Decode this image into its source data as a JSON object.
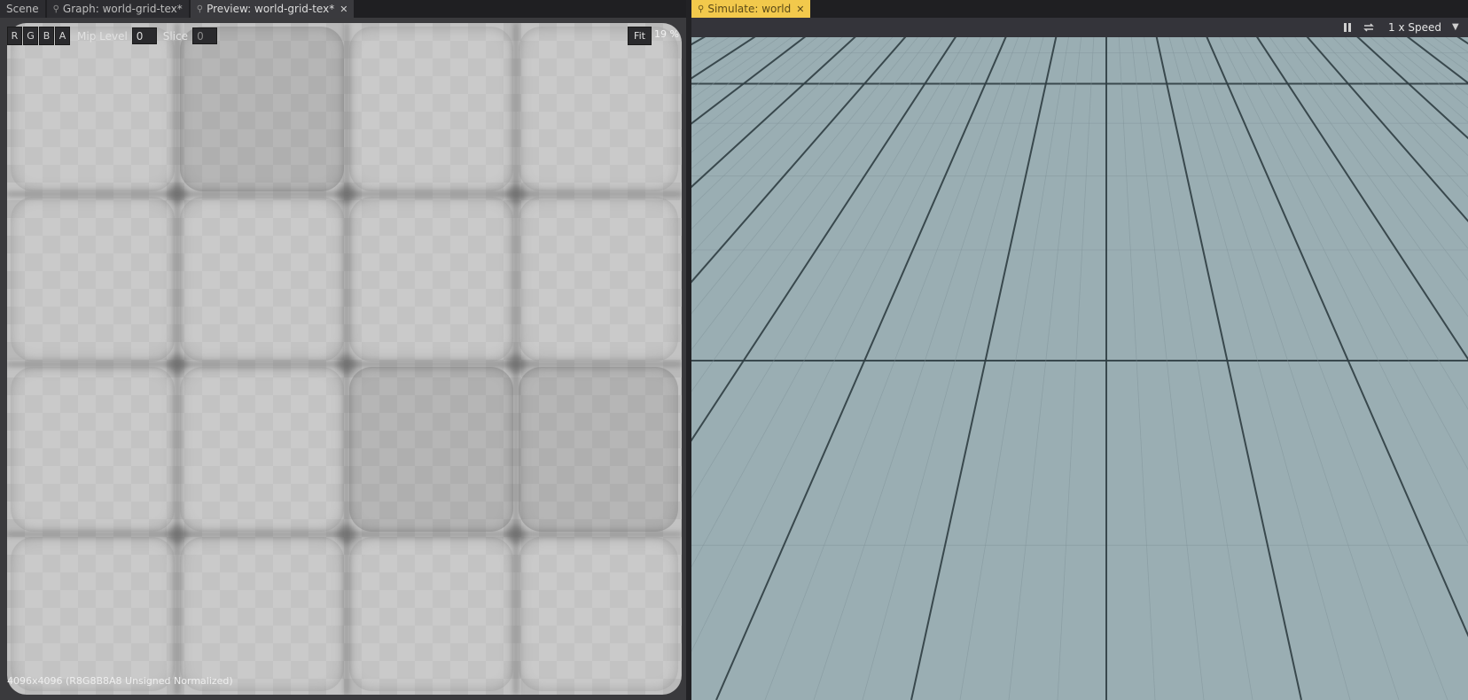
{
  "tabs_left": [
    {
      "label": "Scene",
      "pinned": false,
      "closable": false
    },
    {
      "label": "Graph: world-grid-tex*",
      "pinned": true,
      "closable": false
    },
    {
      "label": "Preview: world-grid-tex*",
      "pinned": true,
      "closable": true
    }
  ],
  "tab_right": {
    "label": "Simulate: world",
    "pinned": true,
    "closable": true
  },
  "preview_toolbar": {
    "channels": [
      "R",
      "G",
      "B",
      "A"
    ],
    "mip_label": "Mip Level",
    "mip_value": "0",
    "slice_label": "Slice",
    "slice_value": "0",
    "fit_label": "Fit",
    "zoom_label": "19 %"
  },
  "status": "4096x4096 (R8G8B8A8 Unsigned Normalized)",
  "sim_toolbar": {
    "speed_label": "1 x Speed",
    "icons": [
      "pause-icon",
      "loop-icon",
      "chevron-down-icon"
    ]
  },
  "colors": {
    "accent": "#f2c94c",
    "floor_tile": "#9aaeb3",
    "floor_line": "#2f3e42"
  }
}
